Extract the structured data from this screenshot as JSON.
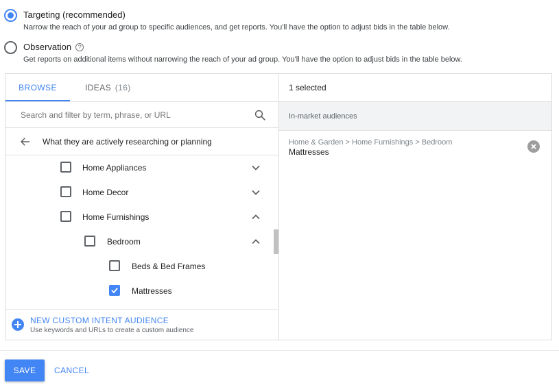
{
  "bidding_options": [
    {
      "label": "Targeting (recommended)",
      "description": "Narrow the reach of your ad group to specific audiences, and get reports. You'll have the option to adjust bids in the table below.",
      "selected": true
    },
    {
      "label": "Observation",
      "description": "Get reports on additional items without narrowing the reach of your ad group. You'll have the option to adjust bids in the table below.",
      "selected": false,
      "help_icon": "help-circle-icon"
    }
  ],
  "tabs": {
    "browse": "BROWSE",
    "ideas": "IDEAS",
    "ideas_count": "(16)"
  },
  "search": {
    "placeholder": "Search and filter by term, phrase, or URL",
    "icon": "search-icon"
  },
  "back_row": {
    "icon": "arrow-left-icon",
    "label": "What they are actively researching or planning"
  },
  "categories": [
    {
      "label": "Home Appliances",
      "checked": false,
      "expanded": false,
      "has_children": true
    },
    {
      "label": "Home Decor",
      "checked": false,
      "expanded": false,
      "has_children": true
    },
    {
      "label": "Home Furnishings",
      "checked": false,
      "expanded": true,
      "has_children": true
    },
    {
      "label": "Bedroom",
      "checked": false,
      "expanded": true,
      "has_children": true
    },
    {
      "label": "Beds & Bed Frames",
      "checked": false,
      "has_children": false
    },
    {
      "label": "Mattresses",
      "checked": true,
      "has_children": false
    }
  ],
  "custom_intent": {
    "title": "NEW CUSTOM INTENT AUDIENCE",
    "subtitle": "Use keywords and URLs to create a custom audience",
    "icon": "plus-circle-icon"
  },
  "selection": {
    "summary": "1 selected",
    "group": "In-market audiences",
    "items": [
      {
        "path": "Home & Garden > Home Furnishings > Bedroom",
        "name": "Mattresses",
        "icon": "remove-circle-icon"
      }
    ]
  },
  "actions": {
    "save": "SAVE",
    "cancel": "CANCEL"
  },
  "colors": {
    "accent": "#4285f4",
    "text": "#212121",
    "muted": "#5f6368",
    "border": "#dadce0"
  }
}
